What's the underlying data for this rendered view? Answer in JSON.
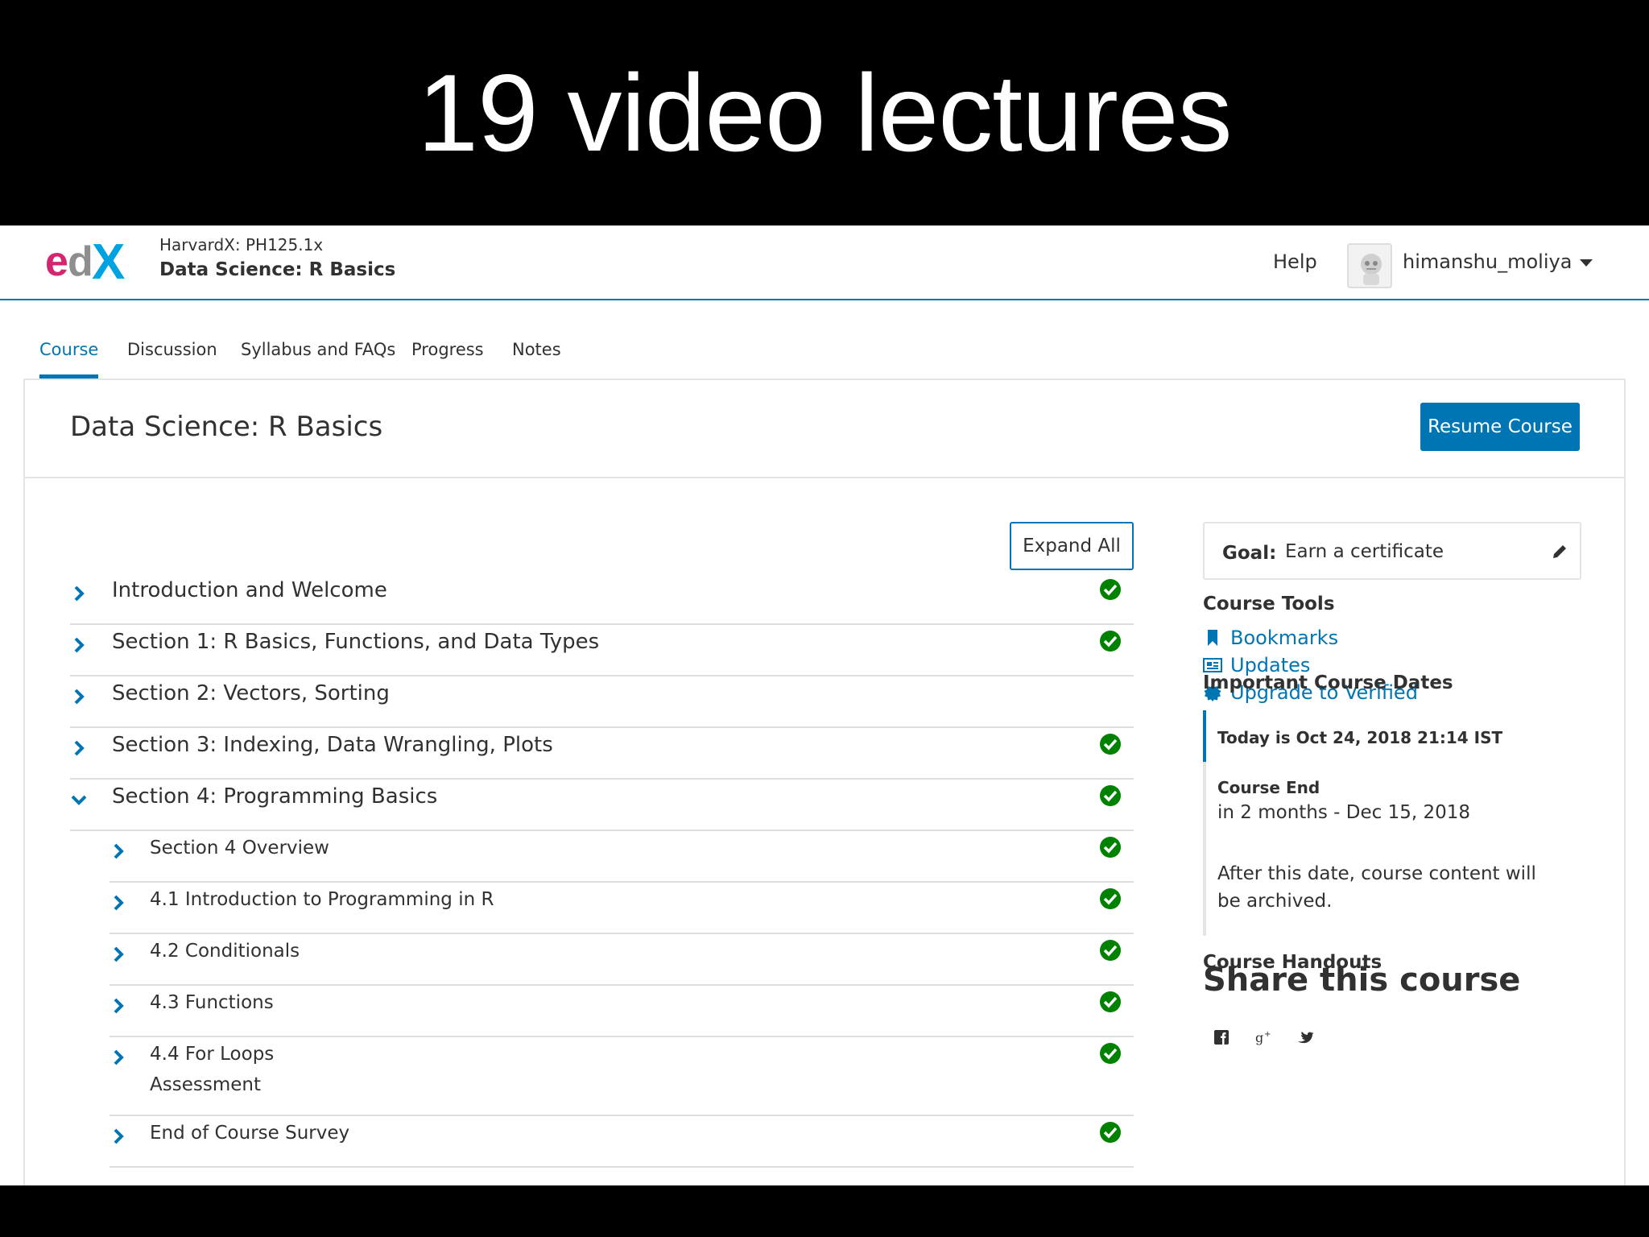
{
  "slide": {
    "title": "19 video lectures"
  },
  "header": {
    "logo_text": "edX",
    "course_org": "HarvardX: PH125.1x",
    "course_name": "Data Science: R Basics",
    "help_label": "Help",
    "username": "himanshu_moliya"
  },
  "tabs": [
    {
      "label": "Course",
      "active": true
    },
    {
      "label": "Discussion"
    },
    {
      "label": "Syllabus and FAQs"
    },
    {
      "label": "Progress"
    },
    {
      "label": "Notes"
    }
  ],
  "main": {
    "title": "Data Science: R Basics",
    "resume_label": "Resume Course",
    "expand_label": "Expand All"
  },
  "outline": {
    "sections": [
      {
        "label": "Introduction and Welcome",
        "completed": true,
        "expanded": false
      },
      {
        "label": "Section 1: R Basics, Functions, and Data Types",
        "completed": true,
        "expanded": false
      },
      {
        "label": "Section 2: Vectors, Sorting",
        "completed": false,
        "expanded": false
      },
      {
        "label": "Section 3: Indexing, Data Wrangling, Plots",
        "completed": true,
        "expanded": false
      },
      {
        "label": "Section 4: Programming Basics",
        "completed": true,
        "expanded": true
      }
    ],
    "subsections": [
      {
        "label": "Section 4 Overview",
        "completed": true
      },
      {
        "label": "4.1 Introduction to Programming in R",
        "completed": true
      },
      {
        "label": "4.2 Conditionals",
        "completed": true
      },
      {
        "label": "4.3 Functions",
        "completed": true
      },
      {
        "label": "4.4 For Loops",
        "sublabel": "Assessment",
        "completed": true
      },
      {
        "label": "End of Course Survey",
        "completed": true
      }
    ]
  },
  "sidebar": {
    "goal_label": "Goal:",
    "goal_value": "Earn a certificate",
    "tools_heading": "Course Tools",
    "tools": [
      {
        "label": "Bookmarks",
        "icon": "bookmark-icon"
      },
      {
        "label": "Updates",
        "icon": "newspaper-icon"
      },
      {
        "label": "Upgrade to Verified",
        "icon": "certificate-icon"
      }
    ],
    "dates_heading": "Important Course Dates",
    "today": "Today is Oct 24, 2018 21:14 IST",
    "end_title": "Course End",
    "end_when": "in 2 months - Dec 15, 2018",
    "end_note": "After this date, course content will be archived.",
    "handouts_heading": "Course Handouts",
    "share_title": "Share this course",
    "social": [
      "facebook-icon",
      "google-plus-icon",
      "twitter-icon"
    ]
  },
  "colors": {
    "accent": "#0075b4",
    "success": "#008100",
    "text": "#313131",
    "logo_magenta": "#d4256f",
    "logo_blue": "#00a2e1",
    "logo_gray": "#8e8e8e"
  }
}
